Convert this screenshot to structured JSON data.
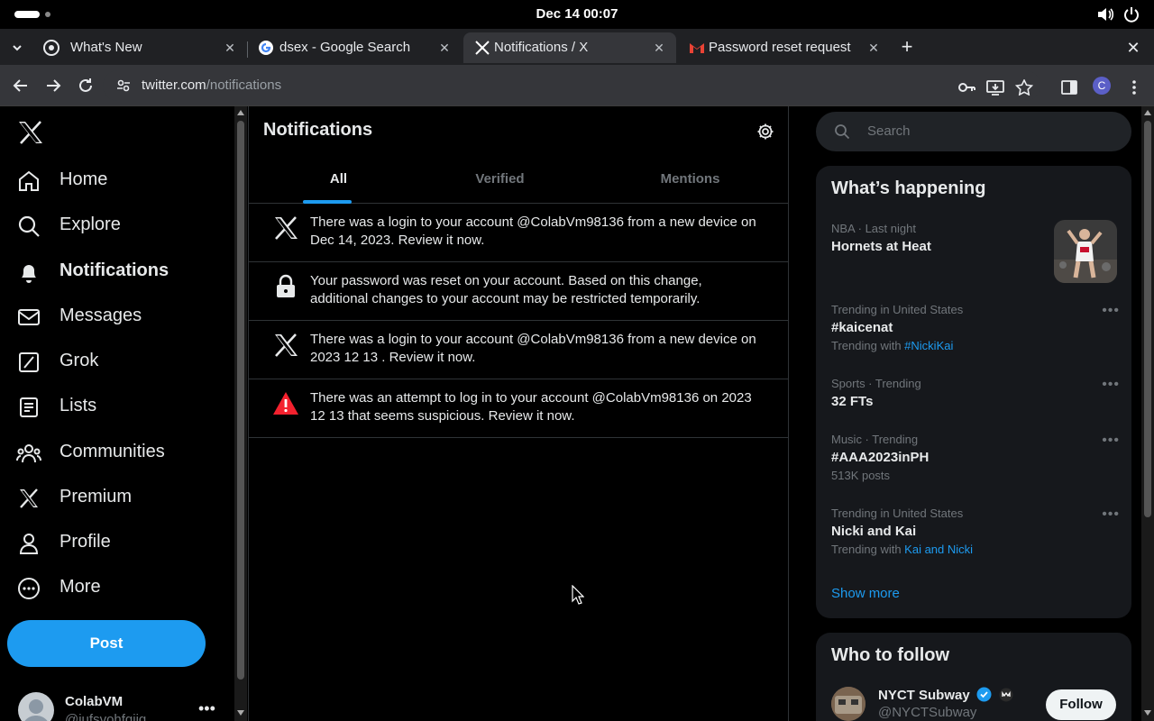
{
  "os": {
    "clock": "Dec 14  00:07"
  },
  "browser": {
    "tabs": [
      {
        "title": "What's New",
        "icon": "chrome-icon"
      },
      {
        "title": "dsex - Google Search",
        "icon": "google-icon"
      },
      {
        "title": "Notifications / X",
        "icon": "x-icon",
        "active": true
      },
      {
        "title": "Password reset request",
        "icon": "gmail-icon"
      }
    ],
    "url_host": "twitter.com",
    "url_path": "/notifications",
    "profile_initial": "C"
  },
  "sidebar": {
    "items": [
      {
        "label": "Home",
        "icon": "home-icon"
      },
      {
        "label": "Explore",
        "icon": "search-icon"
      },
      {
        "label": "Notifications",
        "icon": "bell-icon",
        "active": true
      },
      {
        "label": "Messages",
        "icon": "envelope-icon"
      },
      {
        "label": "Grok",
        "icon": "grok-icon"
      },
      {
        "label": "Lists",
        "icon": "list-icon"
      },
      {
        "label": "Communities",
        "icon": "communities-icon"
      },
      {
        "label": "Premium",
        "icon": "x-icon"
      },
      {
        "label": "Profile",
        "icon": "person-icon"
      },
      {
        "label": "More",
        "icon": "more-circle-icon"
      }
    ],
    "post_label": "Post",
    "account": {
      "name": "ColabVM",
      "handle": "@iufsvohfqiiq"
    }
  },
  "main": {
    "title": "Notifications",
    "tabs": [
      {
        "label": "All",
        "active": true
      },
      {
        "label": "Verified"
      },
      {
        "label": "Mentions"
      }
    ],
    "notifications": [
      {
        "icon": "x-icon",
        "text": "There was a login to your account @ColabVm98136 from a new device on Dec 14, 2023. Review it now."
      },
      {
        "icon": "lock-icon",
        "text": "Your password was reset on your account. Based on this change, additional changes to your account may be restricted temporarily."
      },
      {
        "icon": "x-icon",
        "text": "There was a login to your account @ColabVm98136 from a new device on 2023  12  13   . Review it now."
      },
      {
        "icon": "alert-icon",
        "text": "There was an attempt to log in to your account @ColabVm98136 on 2023  12  13   that seems suspicious. Review it now."
      }
    ]
  },
  "right": {
    "search_placeholder": "Search",
    "happening": {
      "title": "What’s happening",
      "feature": {
        "meta": "NBA · Last night",
        "title": "Hornets at Heat"
      },
      "trends": [
        {
          "meta": "Trending in United States",
          "title": "#kaicenat",
          "sub_prefix": "Trending with ",
          "sub_link": "#NickiKai"
        },
        {
          "meta": "Sports · Trending",
          "title": "32 FTs"
        },
        {
          "meta": "Music · Trending",
          "title": "#AAA2023inPH",
          "sub_text": "513K posts"
        },
        {
          "meta": "Trending in United States",
          "title": "Nicki and Kai",
          "sub_prefix": "Trending with ",
          "sub_link": "Kai and Nicki"
        }
      ],
      "show_more": "Show more"
    },
    "who_to_follow": {
      "title": "Who to follow",
      "accounts": [
        {
          "name": "NYCT Subway",
          "handle": "@NYCTSubway",
          "button": "Follow"
        }
      ]
    }
  },
  "colors": {
    "accent": "#1d9bf0",
    "alert": "#f4212e"
  }
}
